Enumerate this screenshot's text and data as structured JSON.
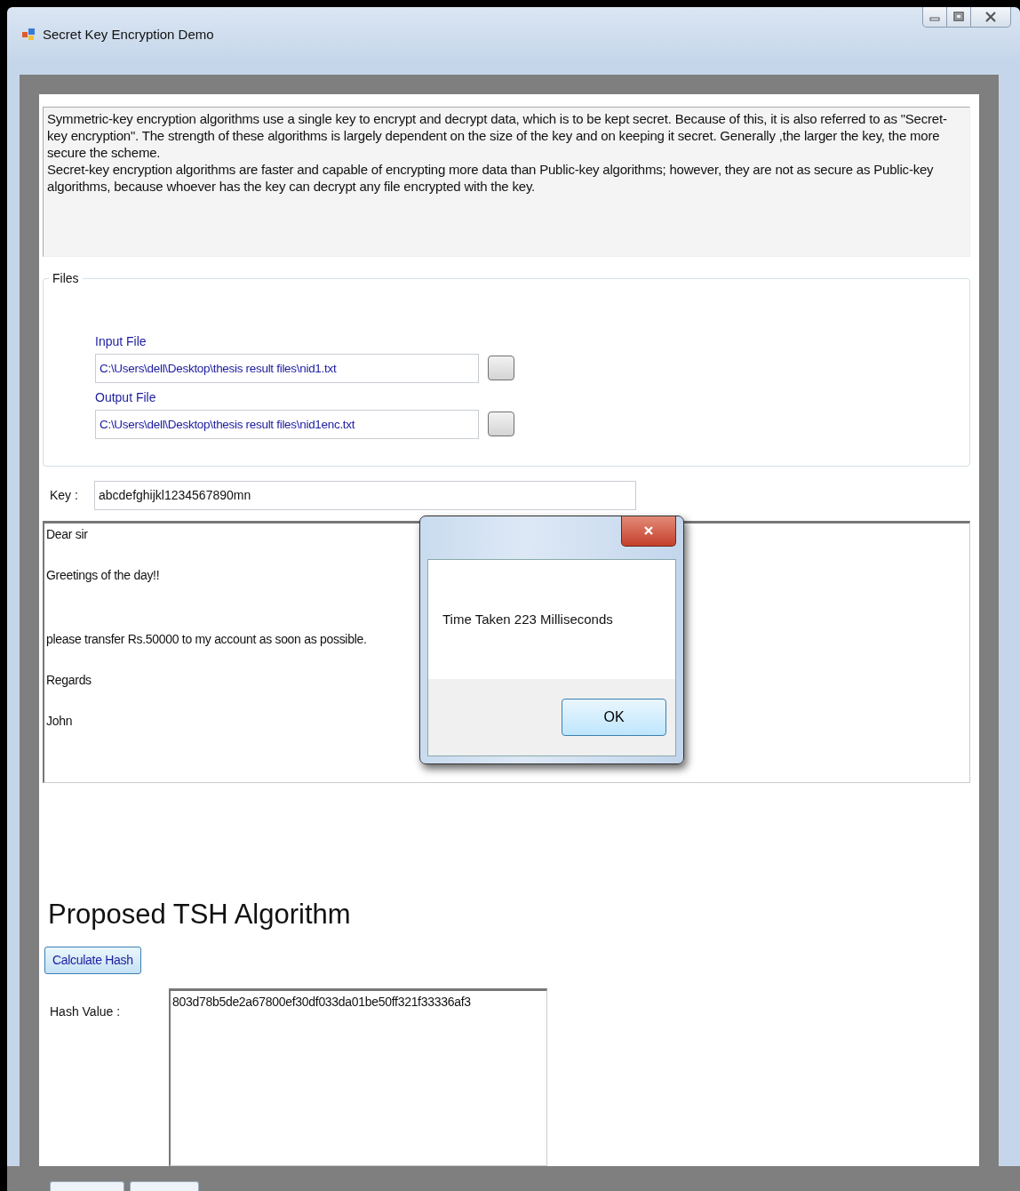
{
  "window": {
    "title": "Secret Key Encryption Demo"
  },
  "description": {
    "paragraphs": [
      "Symmetric-key encryption algorithms use a single key to encrypt and decrypt data, which is to be kept secret. Because of this, it is also referred to as \"Secret-key encryption\". The strength of these algorithms is largely dependent on the size of the key and on keeping it secret. Generally ,the larger the key, the more secure the scheme.",
      "Secret-key encryption algorithms are faster and capable of encrypting more data than Public-key algorithms; however, they are not as secure as Public-key algorithms, because whoever has the key can decrypt any file encrypted with the key."
    ]
  },
  "files_group": {
    "title": "Files",
    "fields": [
      {
        "label": "Input File",
        "value": "C:\\Users\\dell\\Desktop\\thesis result files\\nid1.txt"
      },
      {
        "label": "Output File",
        "value": "C:\\Users\\dell\\Desktop\\thesis result files\\nid1enc.txt"
      }
    ]
  },
  "key": {
    "label": "Key :",
    "value": "abcdefghijkl1234567890mn"
  },
  "message": {
    "lines": [
      {
        "text": "Dear sir",
        "blank_line_before": false
      },
      {
        "text": "Greetings of the day!!",
        "blank_line_before": false
      },
      {
        "text": "please transfer Rs.50000 to my account as soon as possible.",
        "blank_line_before": true
      },
      {
        "text": "Regards",
        "blank_line_before": false
      },
      {
        "text": "John",
        "blank_line_before": false
      }
    ]
  },
  "dialog": {
    "message": "Time Taken 223 Milliseconds",
    "button": "OK"
  },
  "heading": "Proposed TSH Algorithm",
  "calculate_button": "Calculate Hash",
  "hash": {
    "label": "Hash Value :",
    "value": "803d78b5de2a67800ef30df033da01be50ff321f33336af3"
  }
}
